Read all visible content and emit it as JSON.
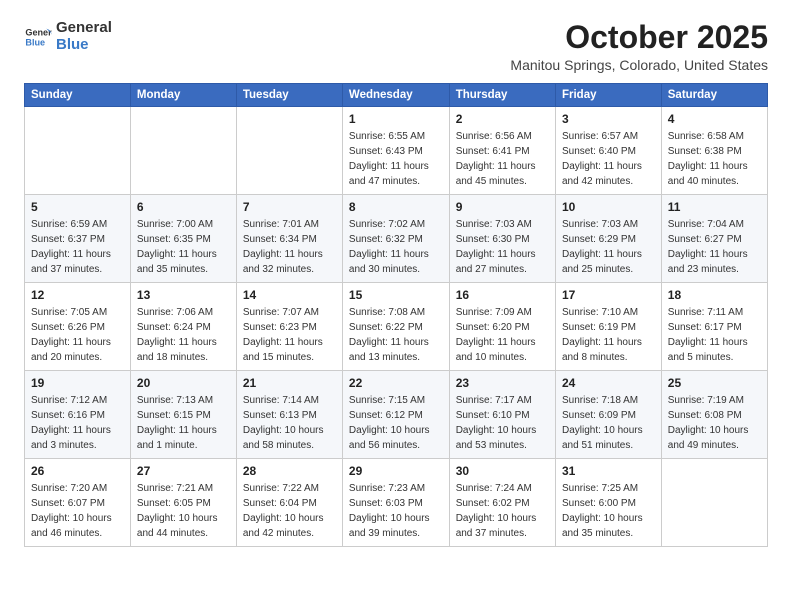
{
  "header": {
    "logo_general": "General",
    "logo_blue": "Blue",
    "month_title": "October 2025",
    "location": "Manitou Springs, Colorado, United States"
  },
  "days_of_week": [
    "Sunday",
    "Monday",
    "Tuesday",
    "Wednesday",
    "Thursday",
    "Friday",
    "Saturday"
  ],
  "weeks": [
    [
      {
        "day": "",
        "info": ""
      },
      {
        "day": "",
        "info": ""
      },
      {
        "day": "",
        "info": ""
      },
      {
        "day": "1",
        "info": "Sunrise: 6:55 AM\nSunset: 6:43 PM\nDaylight: 11 hours\nand 47 minutes."
      },
      {
        "day": "2",
        "info": "Sunrise: 6:56 AM\nSunset: 6:41 PM\nDaylight: 11 hours\nand 45 minutes."
      },
      {
        "day": "3",
        "info": "Sunrise: 6:57 AM\nSunset: 6:40 PM\nDaylight: 11 hours\nand 42 minutes."
      },
      {
        "day": "4",
        "info": "Sunrise: 6:58 AM\nSunset: 6:38 PM\nDaylight: 11 hours\nand 40 minutes."
      }
    ],
    [
      {
        "day": "5",
        "info": "Sunrise: 6:59 AM\nSunset: 6:37 PM\nDaylight: 11 hours\nand 37 minutes."
      },
      {
        "day": "6",
        "info": "Sunrise: 7:00 AM\nSunset: 6:35 PM\nDaylight: 11 hours\nand 35 minutes."
      },
      {
        "day": "7",
        "info": "Sunrise: 7:01 AM\nSunset: 6:34 PM\nDaylight: 11 hours\nand 32 minutes."
      },
      {
        "day": "8",
        "info": "Sunrise: 7:02 AM\nSunset: 6:32 PM\nDaylight: 11 hours\nand 30 minutes."
      },
      {
        "day": "9",
        "info": "Sunrise: 7:03 AM\nSunset: 6:30 PM\nDaylight: 11 hours\nand 27 minutes."
      },
      {
        "day": "10",
        "info": "Sunrise: 7:03 AM\nSunset: 6:29 PM\nDaylight: 11 hours\nand 25 minutes."
      },
      {
        "day": "11",
        "info": "Sunrise: 7:04 AM\nSunset: 6:27 PM\nDaylight: 11 hours\nand 23 minutes."
      }
    ],
    [
      {
        "day": "12",
        "info": "Sunrise: 7:05 AM\nSunset: 6:26 PM\nDaylight: 11 hours\nand 20 minutes."
      },
      {
        "day": "13",
        "info": "Sunrise: 7:06 AM\nSunset: 6:24 PM\nDaylight: 11 hours\nand 18 minutes."
      },
      {
        "day": "14",
        "info": "Sunrise: 7:07 AM\nSunset: 6:23 PM\nDaylight: 11 hours\nand 15 minutes."
      },
      {
        "day": "15",
        "info": "Sunrise: 7:08 AM\nSunset: 6:22 PM\nDaylight: 11 hours\nand 13 minutes."
      },
      {
        "day": "16",
        "info": "Sunrise: 7:09 AM\nSunset: 6:20 PM\nDaylight: 11 hours\nand 10 minutes."
      },
      {
        "day": "17",
        "info": "Sunrise: 7:10 AM\nSunset: 6:19 PM\nDaylight: 11 hours\nand 8 minutes."
      },
      {
        "day": "18",
        "info": "Sunrise: 7:11 AM\nSunset: 6:17 PM\nDaylight: 11 hours\nand 5 minutes."
      }
    ],
    [
      {
        "day": "19",
        "info": "Sunrise: 7:12 AM\nSunset: 6:16 PM\nDaylight: 11 hours\nand 3 minutes."
      },
      {
        "day": "20",
        "info": "Sunrise: 7:13 AM\nSunset: 6:15 PM\nDaylight: 11 hours\nand 1 minute."
      },
      {
        "day": "21",
        "info": "Sunrise: 7:14 AM\nSunset: 6:13 PM\nDaylight: 10 hours\nand 58 minutes."
      },
      {
        "day": "22",
        "info": "Sunrise: 7:15 AM\nSunset: 6:12 PM\nDaylight: 10 hours\nand 56 minutes."
      },
      {
        "day": "23",
        "info": "Sunrise: 7:17 AM\nSunset: 6:10 PM\nDaylight: 10 hours\nand 53 minutes."
      },
      {
        "day": "24",
        "info": "Sunrise: 7:18 AM\nSunset: 6:09 PM\nDaylight: 10 hours\nand 51 minutes."
      },
      {
        "day": "25",
        "info": "Sunrise: 7:19 AM\nSunset: 6:08 PM\nDaylight: 10 hours\nand 49 minutes."
      }
    ],
    [
      {
        "day": "26",
        "info": "Sunrise: 7:20 AM\nSunset: 6:07 PM\nDaylight: 10 hours\nand 46 minutes."
      },
      {
        "day": "27",
        "info": "Sunrise: 7:21 AM\nSunset: 6:05 PM\nDaylight: 10 hours\nand 44 minutes."
      },
      {
        "day": "28",
        "info": "Sunrise: 7:22 AM\nSunset: 6:04 PM\nDaylight: 10 hours\nand 42 minutes."
      },
      {
        "day": "29",
        "info": "Sunrise: 7:23 AM\nSunset: 6:03 PM\nDaylight: 10 hours\nand 39 minutes."
      },
      {
        "day": "30",
        "info": "Sunrise: 7:24 AM\nSunset: 6:02 PM\nDaylight: 10 hours\nand 37 minutes."
      },
      {
        "day": "31",
        "info": "Sunrise: 7:25 AM\nSunset: 6:00 PM\nDaylight: 10 hours\nand 35 minutes."
      },
      {
        "day": "",
        "info": ""
      }
    ]
  ]
}
